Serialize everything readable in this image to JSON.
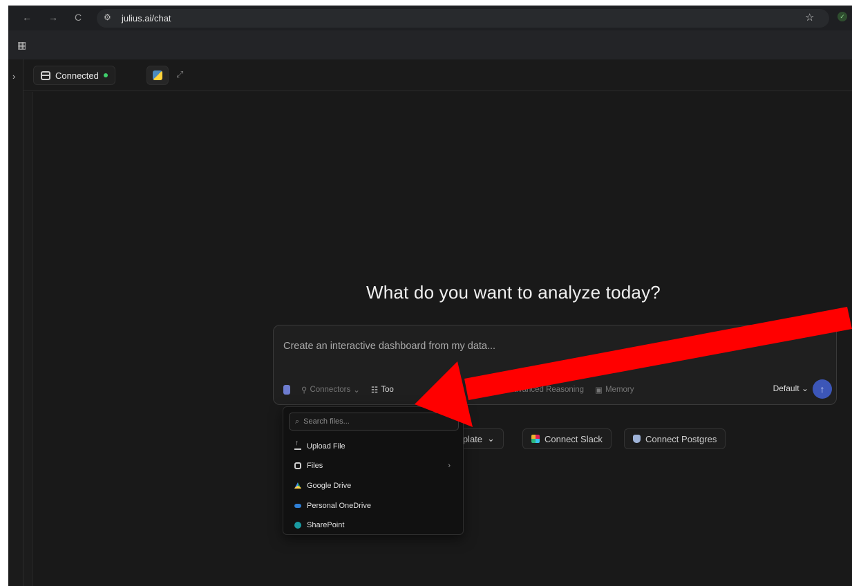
{
  "browser": {
    "url": "julius.ai/chat",
    "nav": {
      "back_icon": "←",
      "forward_icon": "→",
      "reload_icon": "C"
    }
  },
  "toolbar": {
    "connection_label": "Connected",
    "connection_color": "#3fcf6b"
  },
  "main": {
    "heading": "What do you want to analyze today?"
  },
  "composer": {
    "placeholder": "Create an interactive dashboard from my data...",
    "tools": {
      "connectors": "Connectors",
      "tools_label": "Too",
      "reasoning": "Advanced Reasoning",
      "memory": "Memory"
    },
    "model_select": "Default",
    "accent": "#3c56b8"
  },
  "chips": {
    "template_fragment": "mplate",
    "slack": "Connect Slack",
    "postgres": "Connect Postgres"
  },
  "file_menu": {
    "search_placeholder": "Search files...",
    "items": [
      {
        "label": "Upload File",
        "icon": "upload-icon"
      },
      {
        "label": "Files",
        "icon": "files-icon",
        "has_submenu": true
      },
      {
        "label": "Google Drive",
        "icon": "google-drive-icon"
      },
      {
        "label": "Personal OneDrive",
        "icon": "onedrive-icon"
      },
      {
        "label": "SharePoint",
        "icon": "sharepoint-icon"
      }
    ]
  },
  "annotation": {
    "arrow_color": "#ff0000"
  }
}
